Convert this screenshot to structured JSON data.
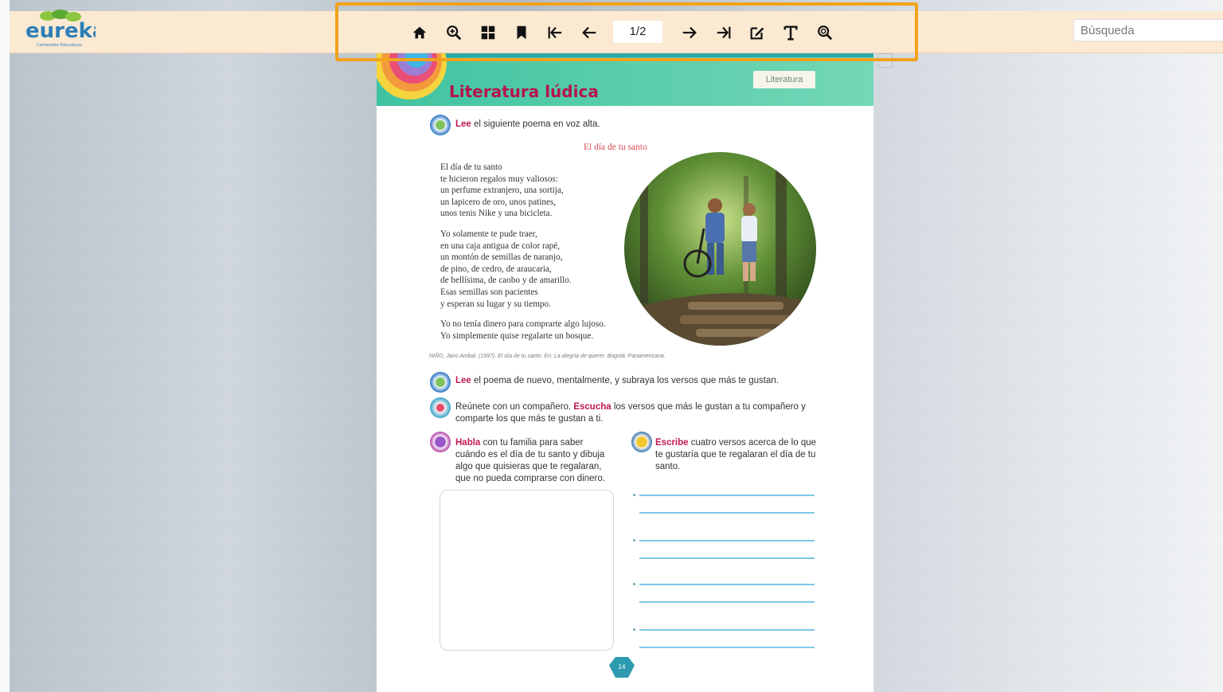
{
  "app": {
    "logo_text": "eureka",
    "logo_tagline": "Contenidos Educativos"
  },
  "toolbar": {
    "buttons": [
      {
        "icon": "home-icon",
        "label": "home"
      },
      {
        "icon": "zoom-in-icon",
        "label": "zoom"
      },
      {
        "icon": "thumbnails-icon",
        "label": "thumbnails"
      },
      {
        "icon": "bookmark-icon",
        "label": "bookmark"
      },
      {
        "icon": "first-page-icon",
        "label": "first page"
      },
      {
        "icon": "previous-page-icon",
        "label": "previous page"
      },
      {
        "icon": "next-page-icon",
        "label": "next page"
      },
      {
        "icon": "last-page-icon",
        "label": "last page"
      },
      {
        "icon": "edit-icon",
        "label": "annotate"
      },
      {
        "icon": "text-icon",
        "label": "text"
      },
      {
        "icon": "search-zoom-icon",
        "label": "find"
      }
    ],
    "page_indicator": "1/2",
    "highlight_color": "#f2a21b"
  },
  "search": {
    "placeholder": "Búsqueda",
    "value": ""
  },
  "colors": {
    "topbar": "#fbe9d2",
    "header_green": "#3fc3a0",
    "accent_magenta": "#b5124d"
  },
  "book": {
    "section_title": "Literatura lúdica",
    "section_tag": "Literatura",
    "instruction_1": {
      "keyword": "Lee",
      "rest": " el siguiente poema en voz alta."
    },
    "poem_title": "El día de tu santo",
    "stanzas": [
      [
        "El día de tu santo",
        "te hicieron regalos muy valiosos:",
        "un perfume extranjero, una sortija,",
        "un lapicero de oro, unos patines,",
        "unos tenis Nike y una bicicleta."
      ],
      [
        "Yo solamente te pude traer,",
        "en una caja antigua de color rapé,",
        "un montón de semillas de naranjo,",
        "de pino, de cedro, de araucaria,",
        "de bellísima, de caobo y de amarillo.",
        "Esas semillas son pacientes",
        "y esperan su lugar y su tiempo."
      ],
      [
        "Yo no tenía dinero para comprarte algo lujoso.",
        "Yo simplemente quise regalarte un bosque."
      ]
    ],
    "citation": "NIÑO, Jairo Aníbal. (1997). El día de tu santo. En: La alegría de querer. Bogotá: Panamericana.",
    "instruction_2": {
      "keyword": "Lee",
      "rest": " el poema de nuevo, mentalmente, y subraya los versos que más te gustan."
    },
    "instruction_3": {
      "pre": "Reúnete con un compañero. ",
      "keyword": "Escucha",
      "rest": " los versos que más le gustan a tu compañero y comparte los que más te gustan a ti."
    },
    "instruction_4": {
      "keyword": "Habla",
      "rest": " con tu familia para saber cuándo es el día de tu santo y dibuja algo que quisieras que te regalaran, que no pueda comprarse con dinero."
    },
    "instruction_5": {
      "keyword": "Escribe",
      "rest": " cuatro versos acerca de lo que te gustaría que te regalaran el día de tu santo."
    },
    "page_number": "14"
  }
}
